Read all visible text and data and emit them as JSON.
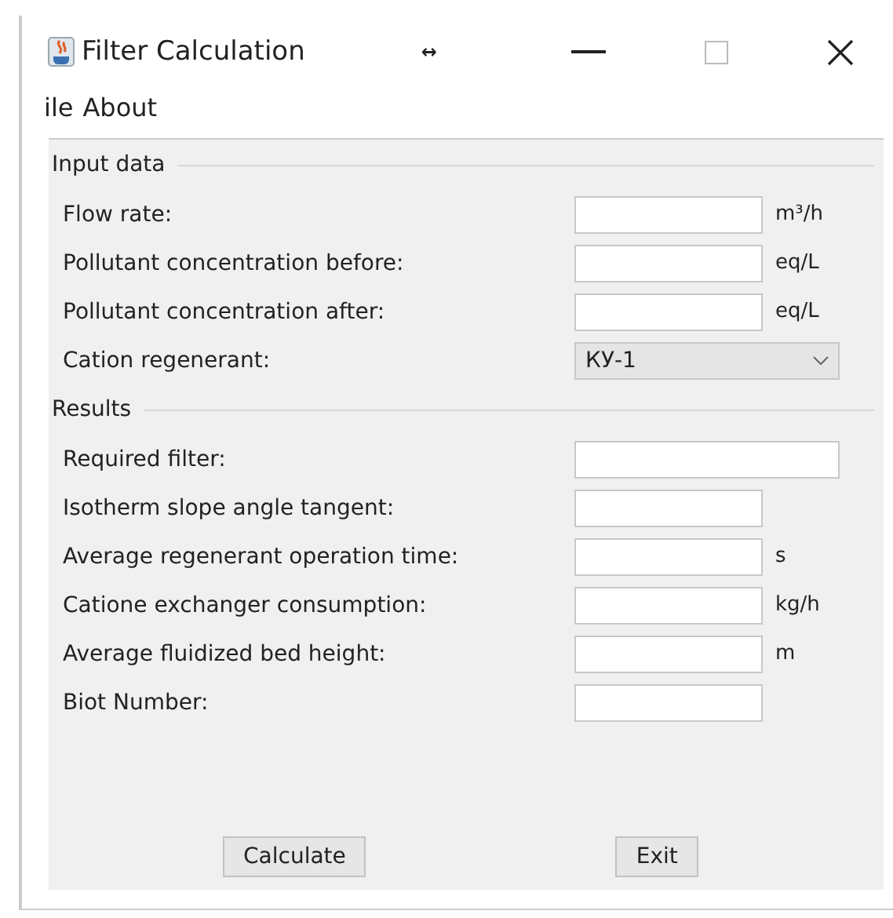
{
  "window": {
    "title": "Filter Calculation",
    "title_marker": "↔"
  },
  "menu": [
    "ile",
    "About"
  ],
  "sections": [
    {
      "title": "Input data",
      "rows": [
        {
          "label": "Flow rate:",
          "kind": "field",
          "unit": "m³/h"
        },
        {
          "label": "Pollutant concentration before:",
          "kind": "field",
          "unit": "eq/L"
        },
        {
          "label": "Pollutant concentration after:",
          "kind": "field",
          "unit": "eq/L"
        },
        {
          "label": "Cation regenerant:",
          "kind": "dropdown",
          "value": "КУ-1"
        }
      ]
    },
    {
      "title": "Results",
      "rows": [
        {
          "label": "Required filter:",
          "kind": "wide-field"
        },
        {
          "label": "Isotherm slope angle tangent:",
          "kind": "field"
        },
        {
          "label": "Average regenerant operation time:",
          "kind": "field",
          "unit": "s"
        },
        {
          "label": "Catione exchanger consumption:",
          "kind": "field",
          "unit": "kg/h"
        },
        {
          "label": "Average fluidized bed height:",
          "kind": "field",
          "unit": "m"
        },
        {
          "label": "Biot Number:",
          "kind": "field"
        }
      ]
    }
  ],
  "buttons": [
    "Calculate",
    "Exit"
  ]
}
